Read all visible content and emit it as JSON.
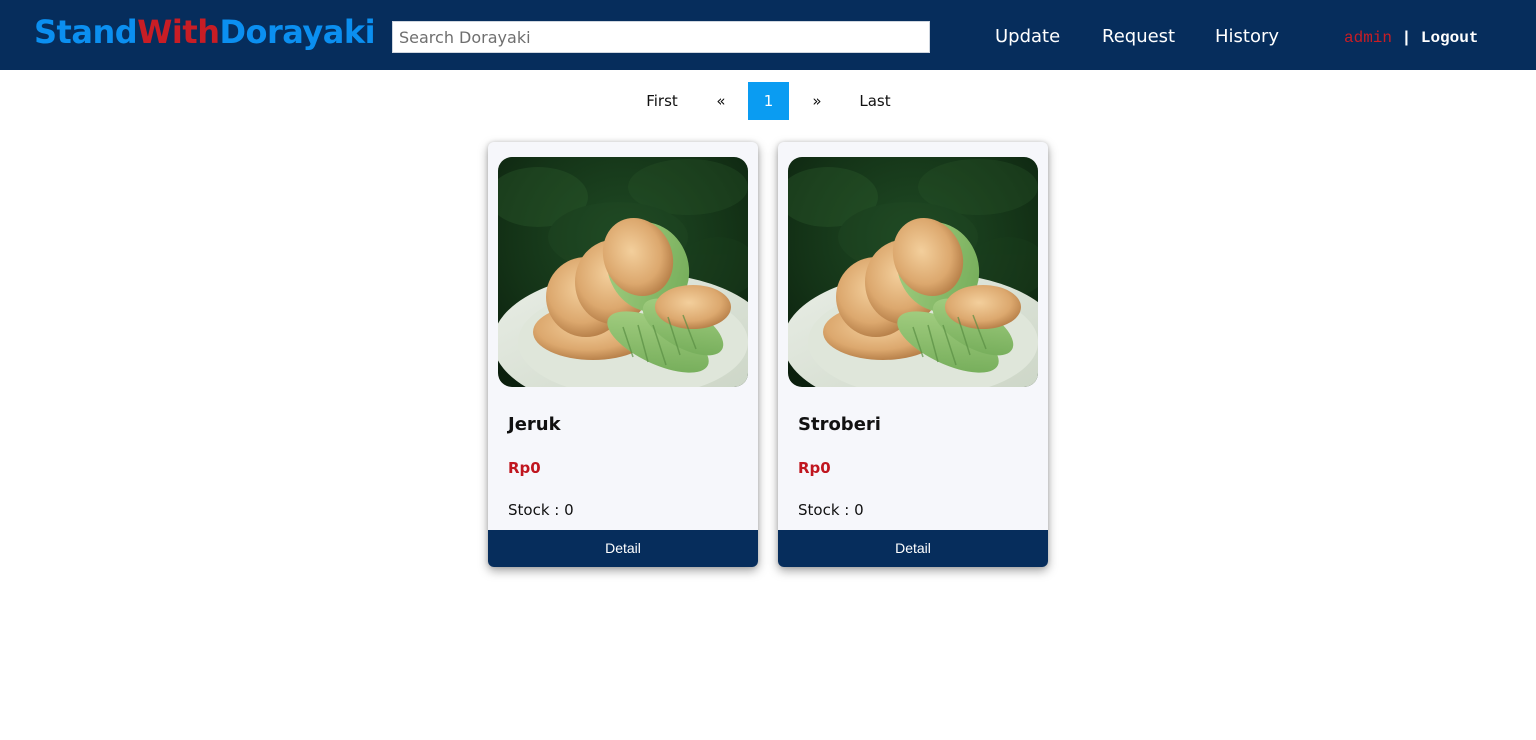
{
  "navbar": {
    "logo": {
      "part1": "Stand",
      "part2": "With",
      "part3": "Dorayaki"
    },
    "search": {
      "placeholder": "Search Dorayaki",
      "value": ""
    },
    "links": [
      "Update",
      "Request",
      "History"
    ],
    "user": {
      "username": "admin",
      "separator": "|",
      "logout": "Logout"
    }
  },
  "pagination": {
    "first": "First",
    "prev": "«",
    "pages": [
      "1"
    ],
    "current_page": "1",
    "next": "»",
    "last": "Last"
  },
  "products": [
    {
      "name": "Jeruk",
      "price": "Rp0",
      "stock": "Stock : 0",
      "button": "Detail",
      "image": "dorayaki-photo"
    },
    {
      "name": "Stroberi",
      "price": "Rp0",
      "stock": "Stock : 0",
      "button": "Detail",
      "image": "dorayaki-photo"
    }
  ],
  "colors": {
    "navbar_bg": "#062d5c",
    "logo_blue": "#0b8ff0",
    "logo_red": "#c81d25",
    "active_page": "#0a9cf2",
    "price_red": "#c0161f",
    "card_bg": "#f6f7fb"
  }
}
